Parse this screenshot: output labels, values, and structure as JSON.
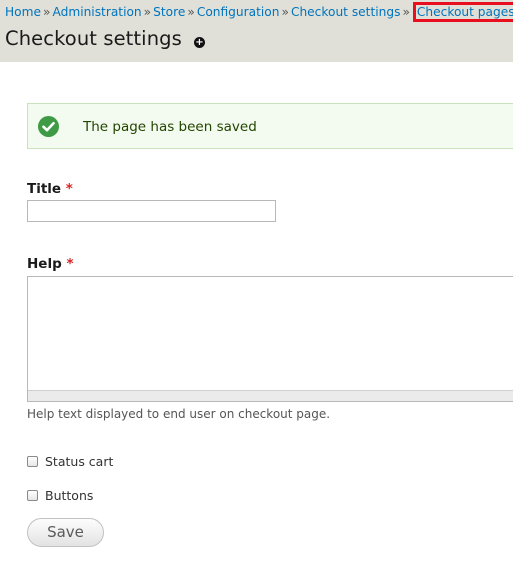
{
  "breadcrumb": {
    "items": [
      "Home",
      "Administration",
      "Store",
      "Configuration",
      "Checkout settings"
    ],
    "separator": "»",
    "current": "Checkout pages"
  },
  "page": {
    "title": "Checkout settings",
    "shortcut_icon": "plus-circle-icon"
  },
  "message": {
    "icon": "check-circle-icon",
    "text": "The page has been saved"
  },
  "form": {
    "title_label": "Title",
    "title_value": "",
    "help_label": "Help",
    "help_value": "",
    "help_description": "Help text displayed to end user on checkout page.",
    "required_marker": "*",
    "status_cart_label": "Status cart",
    "status_cart_checked": false,
    "buttons_label": "Buttons",
    "buttons_checked": false,
    "save_label": "Save"
  },
  "colors": {
    "link": "#0074bd",
    "highlight_border": "#e8101e",
    "header_bg": "#e0e0d8",
    "success_icon": "#3f9a46",
    "required": "#d72222"
  }
}
